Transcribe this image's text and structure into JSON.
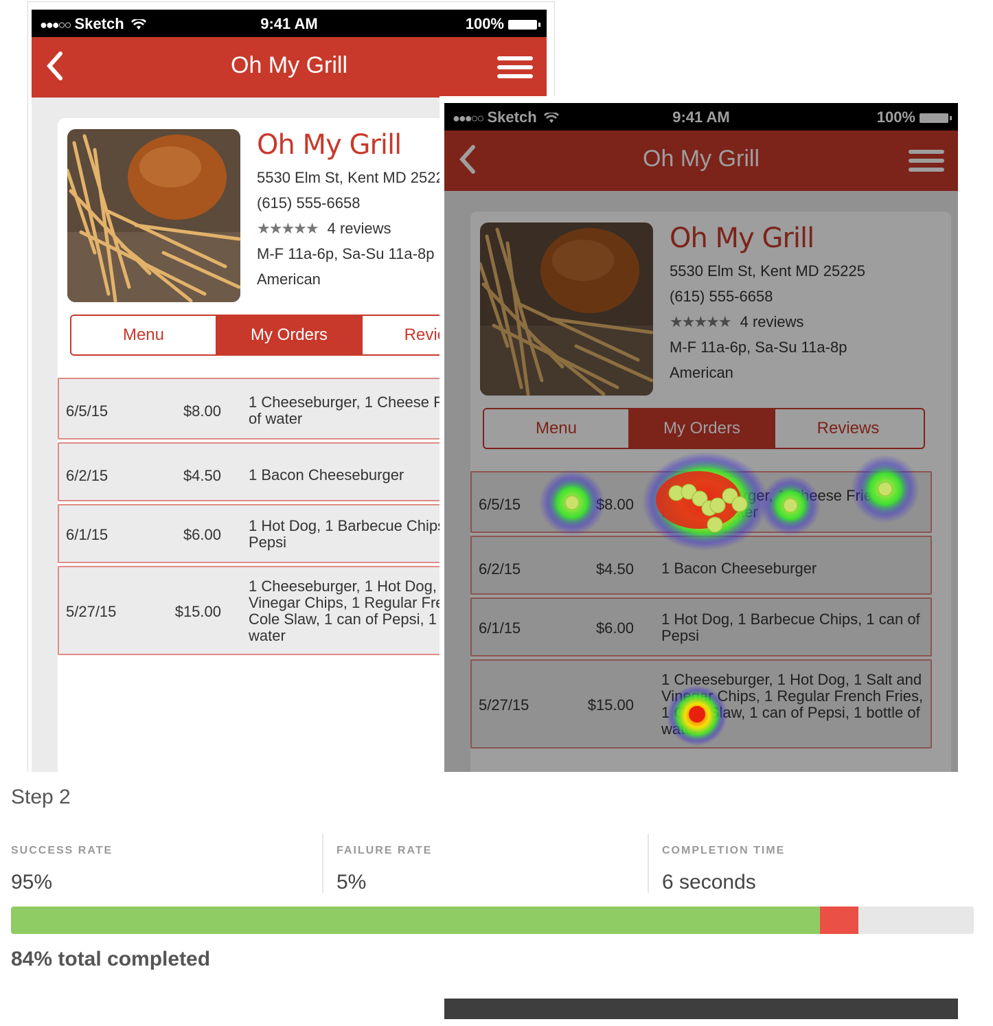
{
  "statusbar": {
    "carrier": "Sketch",
    "time": "9:41 AM",
    "battery": "100%"
  },
  "navbar": {
    "title": "Oh My Grill"
  },
  "restaurant": {
    "name": "Oh My Grill",
    "address": "5530 Elm St, Kent MD 25225",
    "phone": "(615) 555-6658",
    "rating_stars": 4.5,
    "reviews": "4 reviews",
    "hours": "M-F 11a-6p, Sa-Su 11a-8p",
    "cuisine": "American"
  },
  "tabs": [
    {
      "label": "Menu",
      "active": false
    },
    {
      "label": "My Orders",
      "active": true
    },
    {
      "label": "Reviews",
      "active": false
    }
  ],
  "orders": [
    {
      "date": "6/5/15",
      "price": "$8.00",
      "items": "1 Cheeseburger, 1 Cheese Fries, 1 Bottle of water"
    },
    {
      "date": "6/2/15",
      "price": "$4.50",
      "items": "1 Bacon Cheeseburger"
    },
    {
      "date": "6/1/15",
      "price": "$6.00",
      "items": "1 Hot Dog, 1 Barbecue Chips, 1 can of Pepsi"
    },
    {
      "date": "5/27/15",
      "price": "$15.00",
      "items": "1 Cheeseburger, 1 Hot Dog, 1 Salt and Vinegar Chips, 1 Regular French Fries, 1 Cole Slaw, 1 can of Pepsi, 1 bottle of water"
    }
  ],
  "step": {
    "title": "Step 2"
  },
  "stats": [
    {
      "label": "SUCCESS RATE",
      "value": "95%"
    },
    {
      "label": "FAILURE RATE",
      "value": "5%"
    },
    {
      "label": "COMPLETION TIME",
      "value": "6 seconds"
    }
  ],
  "progress": {
    "success_fraction": 0.84,
    "failure_fraction": 0.04,
    "total_label": "84% total completed"
  },
  "colors": {
    "brand": "#c8392b",
    "success": "#8fcc63",
    "failure": "#ea5045",
    "track": "#e7e7e7"
  }
}
